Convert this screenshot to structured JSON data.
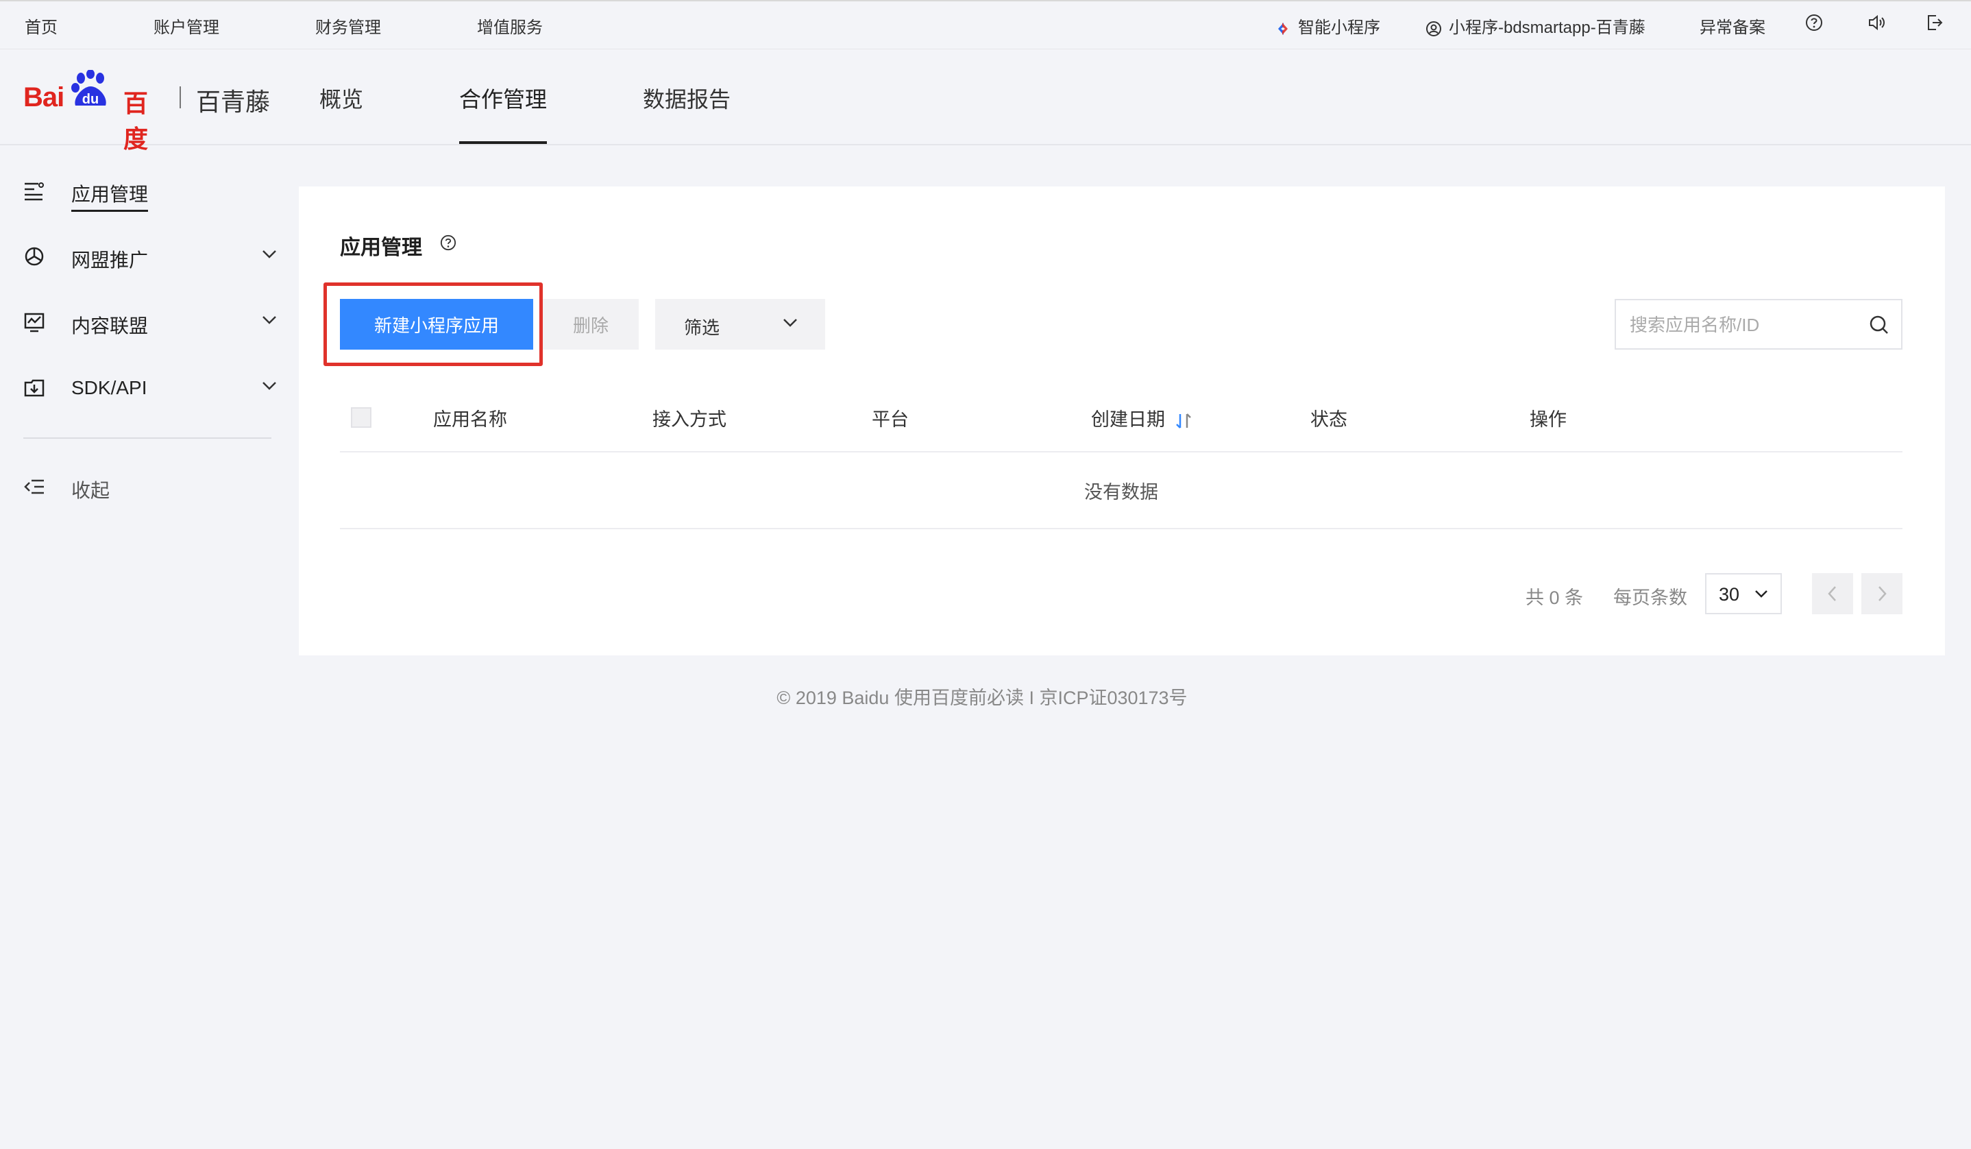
{
  "topbar": {
    "links": [
      "首页",
      "账户管理",
      "财务管理",
      "增值服务"
    ],
    "smart_program": "智能小程序",
    "account": "小程序-bdsmartapp-百青藤",
    "abnormal": "异常备案"
  },
  "header": {
    "logo_bai": "Bai",
    "logo_du": "du",
    "logo_baidu": "百度",
    "product": "百青藤",
    "tabs": [
      "概览",
      "合作管理",
      "数据报告"
    ],
    "active_tab": "合作管理"
  },
  "sidebar": {
    "items": [
      {
        "label": "应用管理",
        "icon": "list-icon",
        "active": true
      },
      {
        "label": "网盟推广",
        "icon": "network-icon"
      },
      {
        "label": "内容联盟",
        "icon": "monitor-chart-icon"
      },
      {
        "label": "SDK/API",
        "icon": "download-box-icon"
      }
    ],
    "collapse": "收起"
  },
  "panel": {
    "title": "应用管理",
    "new_button": "新建小程序应用",
    "delete_button": "删除",
    "filter_label": "筛选",
    "search_placeholder": "搜索应用名称/ID",
    "columns": [
      "应用名称",
      "接入方式",
      "平台",
      "创建日期",
      "状态",
      "操作"
    ],
    "empty": "没有数据",
    "pager": {
      "total": "共 0 条",
      "per_page_label": "每页条数",
      "per_page": "30"
    }
  },
  "footer": {
    "text": "©  2019 Baidu  使用百度前必读 I 京ICP证030173号"
  },
  "colors": {
    "primary": "#3388ff",
    "highlight": "#e0322b",
    "brand_red": "#e0251f",
    "brand_blue": "#2932e1"
  }
}
